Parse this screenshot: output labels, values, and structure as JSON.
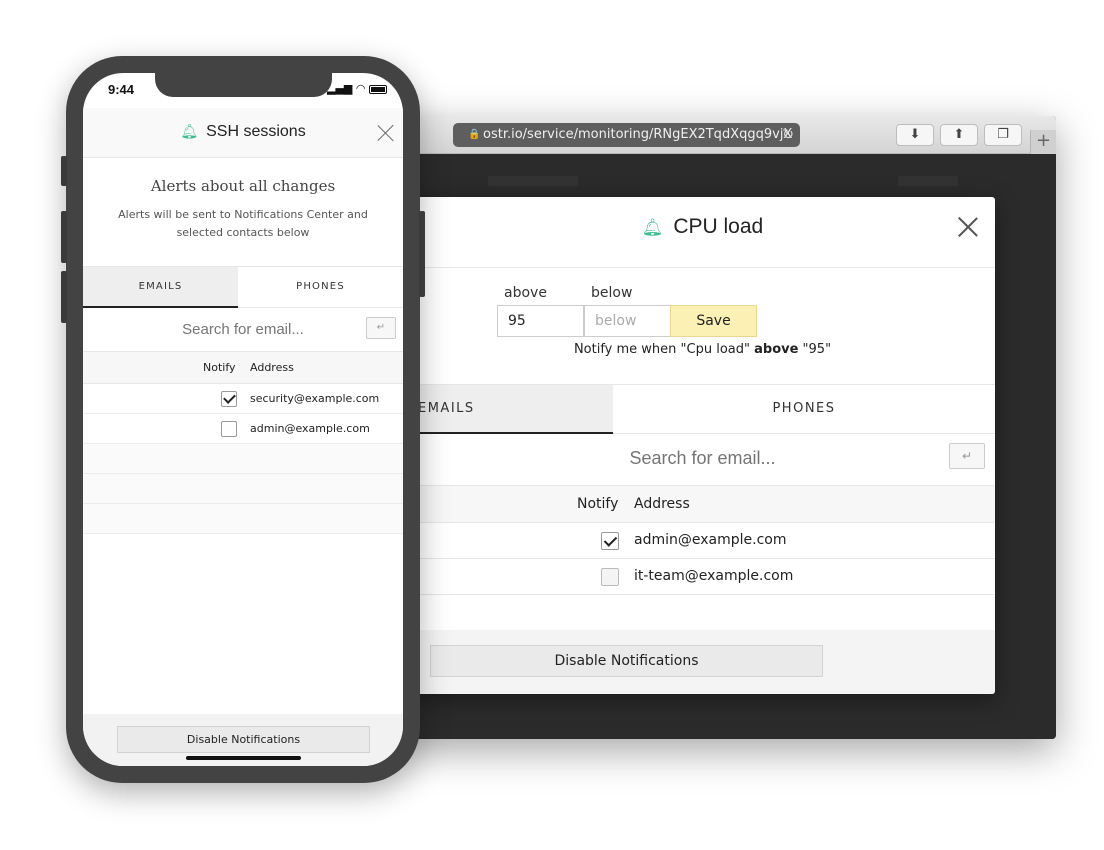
{
  "browser": {
    "url": "ostr.io/service/monitoring/RNgEX2TqdXqgq9vjX",
    "new_tab_symbol": "+"
  },
  "desktop_modal": {
    "title": "CPU load",
    "threshold": {
      "above_label": "above",
      "below_label": "below",
      "above_value": "95",
      "below_placeholder": "below",
      "save_label": "Save",
      "notify_prefix": "Notify me when \"Cpu load\" ",
      "notify_keyword": "above",
      "notify_suffix": " \"95\""
    },
    "tabs": [
      {
        "label": "EMAILS",
        "active": true
      },
      {
        "label": "PHONES",
        "active": false
      }
    ],
    "search_placeholder": "Search for email...",
    "table": {
      "headers": {
        "notify": "Notify",
        "address": "Address"
      },
      "rows": [
        {
          "address": "admin@example.com",
          "checked": true
        },
        {
          "address": "it-team@example.com",
          "checked": false
        }
      ]
    },
    "disable_label": "Disable Notifications"
  },
  "phone": {
    "status_time": "9:44",
    "title": "SSH sessions",
    "alert_title": "Alerts about all changes",
    "alert_subtitle": "Alerts will be sent to Notifications Center and selected contacts below",
    "tabs": [
      {
        "label": "EMAILS",
        "active": true
      },
      {
        "label": "PHONES",
        "active": false
      }
    ],
    "search_placeholder": "Search for email...",
    "table": {
      "headers": {
        "notify": "Notify",
        "address": "Address"
      },
      "rows": [
        {
          "address": "security@example.com",
          "checked": true
        },
        {
          "address": "admin@example.com",
          "checked": false
        }
      ]
    },
    "disable_label": "Disable Notifications"
  },
  "colors": {
    "accent_bell": "#3cbf8c",
    "save_button": "#fbf1b5"
  }
}
